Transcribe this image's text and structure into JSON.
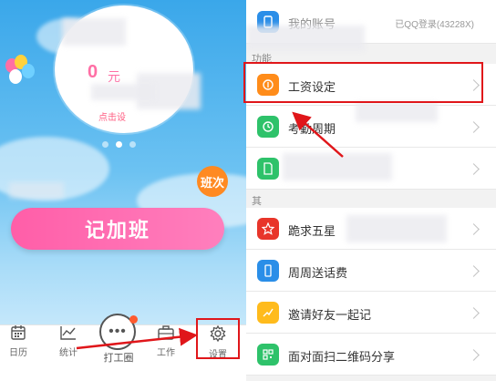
{
  "left_panel": {
    "salary_amount": "0",
    "salary_unit": "元",
    "salary_hint": "点击设",
    "shift_button": "班次",
    "overtime_button": "记加班",
    "tabs": [
      {
        "label": "日历",
        "icon": "calendar-icon"
      },
      {
        "label": "统计",
        "icon": "chart-icon"
      },
      {
        "label": "打工圈",
        "icon": "chat-bubble-icon"
      },
      {
        "label": "工作",
        "icon": "briefcase-icon"
      },
      {
        "label": "设置",
        "icon": "gear-icon"
      }
    ],
    "carousel_pages": 3,
    "carousel_active": 2
  },
  "right_panel": {
    "account": {
      "label": "我的账号",
      "value": "已QQ登录(43228X)"
    },
    "section_function": "功能",
    "rows": [
      {
        "label": "工资设定",
        "icon": "wallet-icon",
        "color": "#ff8c1a"
      },
      {
        "label": "考勤周期",
        "icon": "clock-icon",
        "color": "#2ec26a"
      },
      {
        "label": "",
        "icon": "document-icon",
        "color": "#2ec26a"
      }
    ],
    "section_other": "其",
    "rows2": [
      {
        "label": "跪求五星",
        "icon": "star-icon",
        "color": "#e8352a"
      },
      {
        "label": "周周送话费",
        "icon": "phone-icon",
        "color": "#2a8ee8"
      },
      {
        "label": "邀请好友一起记",
        "icon": "trend-icon",
        "color": "#ffbb1c"
      },
      {
        "label": "面对面扫二维码分享",
        "icon": "qrcode-icon",
        "color": "#2ec26a"
      }
    ]
  },
  "colors": {
    "accent_pink": "#ff5ea8",
    "highlight_red": "#e0161a",
    "shift_orange": "#ff8a22"
  }
}
